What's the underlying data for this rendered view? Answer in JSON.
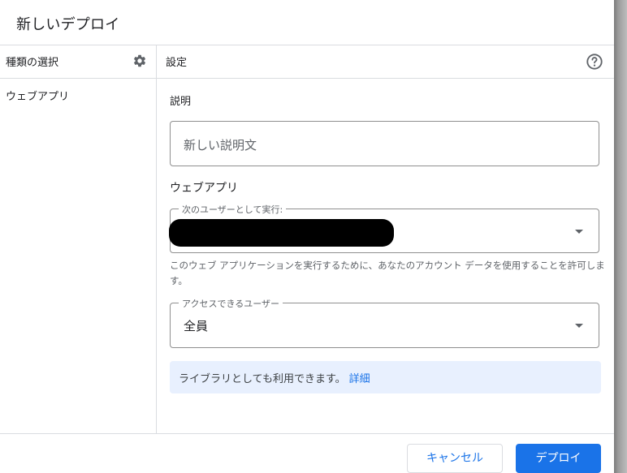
{
  "dialog": {
    "title": "新しいデプロイ"
  },
  "left_panel": {
    "header": "種類の選択",
    "header_icon": "gear-icon",
    "items": [
      {
        "label": "ウェブアプリ"
      }
    ]
  },
  "right_panel": {
    "header": "設定",
    "header_icon": "help-circle-icon",
    "description": {
      "label": "説明",
      "placeholder": "新しい説明文"
    },
    "webapp": {
      "title": "ウェブアプリ",
      "execute_as": {
        "label": "次のユーザーとして実行:",
        "value_redacted": true
      },
      "execute_help": "このウェブ アプリケーションを実行するために、あなたのアカウント データを使用することを許可します。",
      "access": {
        "label": "アクセスできるユーザー",
        "value": "全員"
      }
    },
    "info": {
      "text": "ライブラリとしても利用できます。",
      "link": "詳細"
    }
  },
  "footer": {
    "cancel_label": "キャンセル",
    "deploy_label": "デプロイ"
  },
  "colors": {
    "accent": "#1a73e8",
    "info_background": "#e8f0fe",
    "border": "#dadce0"
  }
}
